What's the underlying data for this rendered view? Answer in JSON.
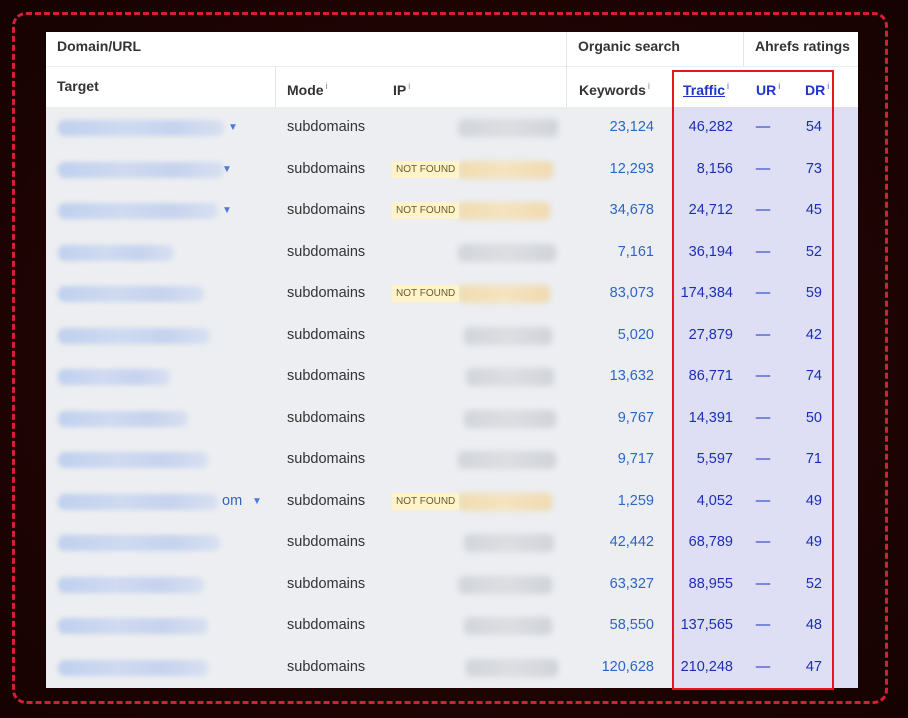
{
  "table": {
    "group_headers": {
      "domain": "Domain/URL",
      "organic": "Organic search",
      "ratings": "Ahrefs ratings"
    },
    "columns": {
      "target": "Target",
      "mode": "Mode",
      "ip": "IP",
      "keywords": "Keywords",
      "traffic": "Traffic",
      "ur": "UR",
      "dr": "DR"
    },
    "info_mark": "i",
    "not_found": "NOT FOUND",
    "row_tail": "om",
    "rows": [
      {
        "mode": "subdomains",
        "keywords": "23,124",
        "traffic": "46,282",
        "ur": "—",
        "dr": "54"
      },
      {
        "mode": "subdomains",
        "keywords": "12,293",
        "traffic": "8,156",
        "ur": "—",
        "dr": "73"
      },
      {
        "mode": "subdomains",
        "keywords": "34,678",
        "traffic": "24,712",
        "ur": "—",
        "dr": "45"
      },
      {
        "mode": "subdomains",
        "keywords": "7,161",
        "traffic": "36,194",
        "ur": "—",
        "dr": "52"
      },
      {
        "mode": "subdomains",
        "keywords": "83,073",
        "traffic": "174,384",
        "ur": "—",
        "dr": "59"
      },
      {
        "mode": "subdomains",
        "keywords": "5,020",
        "traffic": "27,879",
        "ur": "—",
        "dr": "42"
      },
      {
        "mode": "subdomains",
        "keywords": "13,632",
        "traffic": "86,771",
        "ur": "—",
        "dr": "74"
      },
      {
        "mode": "subdomains",
        "keywords": "9,767",
        "traffic": "14,391",
        "ur": "—",
        "dr": "50"
      },
      {
        "mode": "subdomains",
        "keywords": "9,717",
        "traffic": "5,597",
        "ur": "—",
        "dr": "71"
      },
      {
        "mode": "subdomains",
        "keywords": "1,259",
        "traffic": "4,052",
        "ur": "—",
        "dr": "49"
      },
      {
        "mode": "subdomains",
        "keywords": "42,442",
        "traffic": "68,789",
        "ur": "—",
        "dr": "49"
      },
      {
        "mode": "subdomains",
        "keywords": "63,327",
        "traffic": "88,955",
        "ur": "—",
        "dr": "52"
      },
      {
        "mode": "subdomains",
        "keywords": "58,550",
        "traffic": "137,565",
        "ur": "—",
        "dr": "48"
      },
      {
        "mode": "subdomains",
        "keywords": "120,628",
        "traffic": "210,248",
        "ur": "—",
        "dr": "47"
      }
    ]
  },
  "colors": {
    "highlight_border": "#e8141f",
    "ratings_band": "#dedff5",
    "link_blue": "#2b66c6",
    "dark_blue": "#1a2fb5"
  }
}
